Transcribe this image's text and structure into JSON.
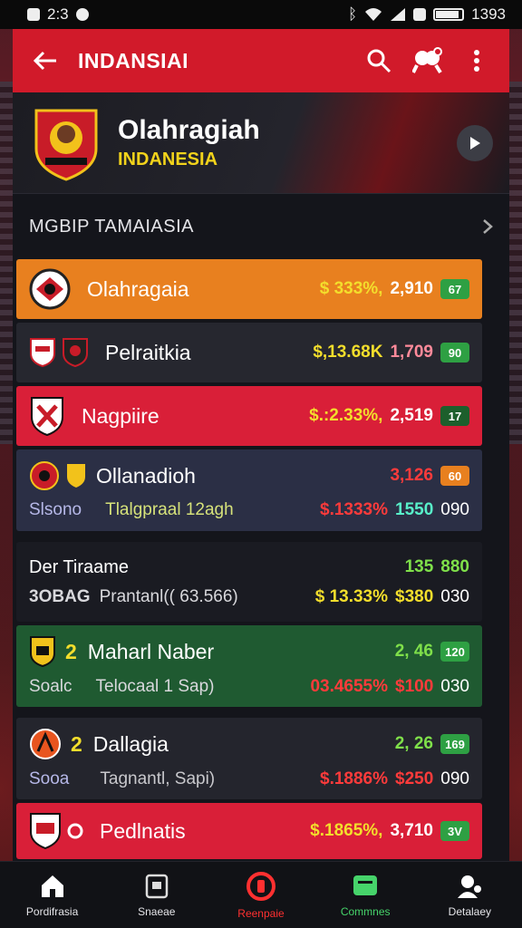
{
  "status": {
    "time": "2:3",
    "battery_text": "1393"
  },
  "appbar": {
    "title": "INDANSIAI"
  },
  "hero": {
    "title": "Olahragiah",
    "subtitle": "INDANESIA"
  },
  "section": {
    "title": "MGBIP TAMAIASIA"
  },
  "rows": [
    {
      "name": "Olahragaia",
      "value": "$  333%,",
      "count": "2,910",
      "pill": "67"
    },
    {
      "name": "Pelraitkia",
      "value": "$,13.68K",
      "count": "1,709",
      "pill": "90"
    },
    {
      "name": "Nagpiire",
      "value": "$.:2.33%,",
      "count": "2,519",
      "pill": "17"
    },
    {
      "name": "Ollanadioh",
      "sub_left": "Slsono",
      "sub_mid": "Tlalgpraal 12agh",
      "value": "$.1333%",
      "top_right": "3,126",
      "pill": "60",
      "bottom_right": "1550",
      "bottom_extra": "090"
    },
    {
      "name": "Der Tiraame",
      "sub_left": "3OBAG",
      "sub_mid": "Prantanl(( 63.566)",
      "value": "$ 13.33%",
      "top_right": "135",
      "top_extra": "880",
      "bottom_right": "$380",
      "bottom_extra": "030"
    },
    {
      "number": "2",
      "name": "Maharl Naber",
      "sub_left": "Soalc",
      "sub_mid": "Telocaal 1 Sap)",
      "value": "03.4655%",
      "top_right": "2, 46",
      "pill": "120",
      "bottom_right": "$100",
      "bottom_extra": "030"
    },
    {
      "number": "2",
      "name": "Dallagia",
      "sub_left": "Sooa",
      "sub_mid": "Tagnantl, Sapi)",
      "value": "$.1886%",
      "top_right": "2, 26",
      "pill": "169",
      "bottom_right": "$250",
      "bottom_extra": "090"
    },
    {
      "name": "Pedlnatis",
      "value": "$.1865%,",
      "count": "3,710",
      "pill": "3V"
    }
  ],
  "nav": [
    {
      "label": "Pordifrasia",
      "icon": "home-icon"
    },
    {
      "label": "Snaeae",
      "icon": "scoreboard-icon"
    },
    {
      "label": "Reenpaie",
      "icon": "record-icon"
    },
    {
      "label": "Commnes",
      "icon": "chat-icon"
    },
    {
      "label": "Detalaey",
      "icon": "profile-icon"
    }
  ],
  "colors": {
    "brand_red": "#d11a2a",
    "highlight_yellow": "#f2d31b",
    "positive_green": "#7fe04a"
  }
}
